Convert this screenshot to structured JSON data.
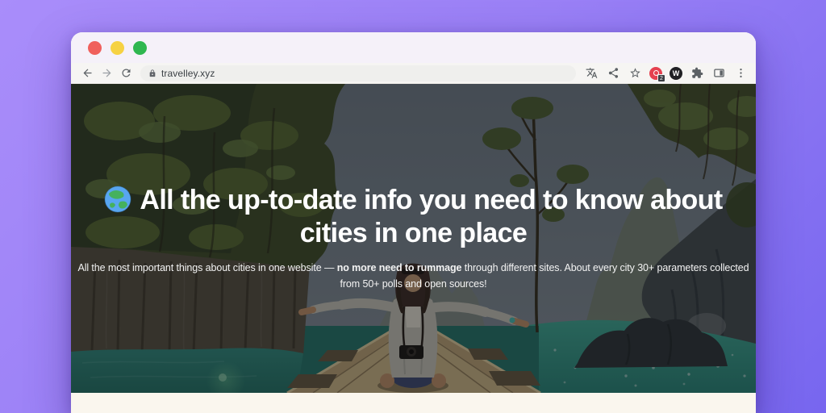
{
  "background": {
    "gradient_from": "#a98dfa",
    "gradient_to": "#7766ef"
  },
  "browser": {
    "window_controls": {
      "close": "#f0605c",
      "minimize": "#f6d243",
      "zoom": "#2fb750"
    },
    "address_bar": {
      "url": "travelley.xyz"
    },
    "toolbar_icons_left": [
      "back",
      "forward",
      "reload"
    ],
    "toolbar_icons_right": [
      "translate",
      "share",
      "bookmark-star",
      "adblock-extension",
      "dark-extension",
      "extensions-puzzle",
      "side-panel",
      "menu"
    ],
    "extensions": {
      "badge_count": "2",
      "monogram": "W"
    }
  },
  "hero": {
    "icon": "globe-emoji",
    "title": "All the up-to-date info you need to know about cities in one place",
    "subtitle": {
      "prefix": "All the most important things about cities in one website — ",
      "bold": "no more need to rummage",
      "suffix": " through different sites. About every city 30+ parameters collected from 50+ polls and open sources!"
    },
    "colors": {
      "overlay": "rgba(6,8,11,0.45)",
      "next_section_bg": "#faf6ee"
    }
  }
}
